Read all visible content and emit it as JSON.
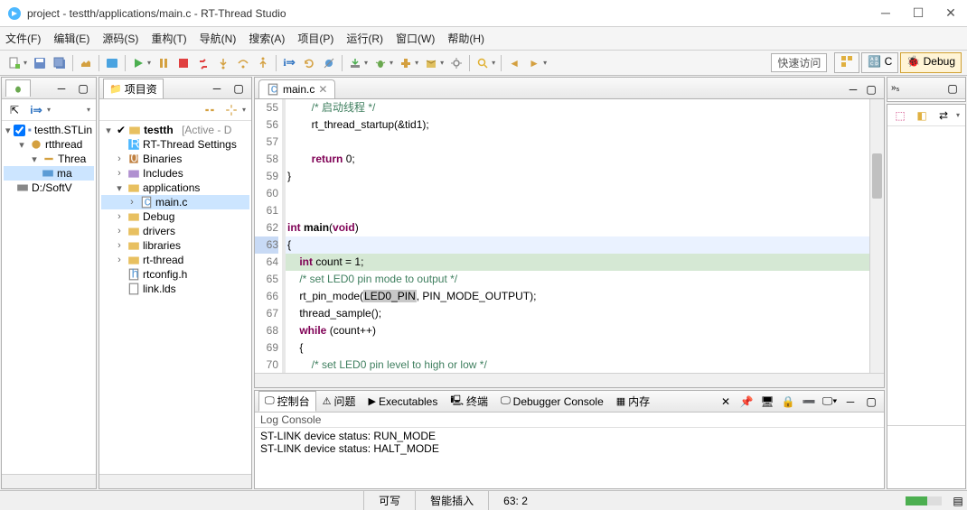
{
  "window": {
    "title": "project - testth/applications/main.c - RT-Thread Studio"
  },
  "menus": [
    "文件(F)",
    "编辑(E)",
    "源码(S)",
    "重构(T)",
    "导航(N)",
    "搜索(A)",
    "项目(P)",
    "运行(R)",
    "窗口(W)",
    "帮助(H)"
  ],
  "quick_access": "快速访问",
  "perspectives": {
    "c": "C",
    "debug": "Debug"
  },
  "left_panel_tree": {
    "root": "testth.STLin",
    "sub1": "rtthread",
    "sub2": "Threa",
    "leaf": "ma",
    "sibling": "D:/SoftV"
  },
  "proj_panel": {
    "title": "项目资",
    "root": "testth",
    "root_suffix": "[Active - D",
    "items": [
      "RT-Thread Settings",
      "Binaries",
      "Includes",
      "applications",
      "main.c",
      "Debug",
      "drivers",
      "libraries",
      "rt-thread",
      "rtconfig.h",
      "link.lds"
    ]
  },
  "editor": {
    "tab": "main.c",
    "lines": [
      {
        "n": 55,
        "html": "        <span class='cm'>/* 启动线程 */</span>"
      },
      {
        "n": 56,
        "html": "        rt_thread_startup(&amp;tid1);"
      },
      {
        "n": 57,
        "html": ""
      },
      {
        "n": 58,
        "html": "        <span class='kw'>return</span> <span class='num'>0</span>;"
      },
      {
        "n": 59,
        "html": "}"
      },
      {
        "n": 60,
        "html": ""
      },
      {
        "n": 61,
        "html": ""
      },
      {
        "n": 62,
        "html": "<span class='kw'>int</span> <span class='fn bold'>main</span>(<span class='kw'>void</span>)",
        "fold": true
      },
      {
        "n": 63,
        "html": "{",
        "cur": true
      },
      {
        "n": 64,
        "html": "    <span class='kw'>int</span> count = <span class='num'>1</span>;",
        "new": true
      },
      {
        "n": 65,
        "html": "    <span class='cm'>/* set LED0 pin mode to output */</span>"
      },
      {
        "n": 66,
        "html": "    rt_pin_mode(<span class='hbox'>LED0_PIN</span>, PIN_MODE_OUTPUT);"
      },
      {
        "n": 67,
        "html": "    thread_sample();"
      },
      {
        "n": 68,
        "html": "    <span class='kw'>while</span> (count++)"
      },
      {
        "n": 69,
        "html": "    {"
      },
      {
        "n": 70,
        "html": "        <span class='cm'>/* set LED0 pin level to high or low */</span>"
      }
    ]
  },
  "bottom_tabs": [
    "控制台",
    "问题",
    "Executables",
    "终端",
    "Debugger Console",
    "内存"
  ],
  "console_title": "Log Console",
  "console_lines": [
    "ST-LINK device status: RUN_MODE",
    "ST-LINK device status: HALT_MODE"
  ],
  "status": {
    "writable": "可写",
    "insert": "智能插入",
    "pos": "63: 2"
  }
}
